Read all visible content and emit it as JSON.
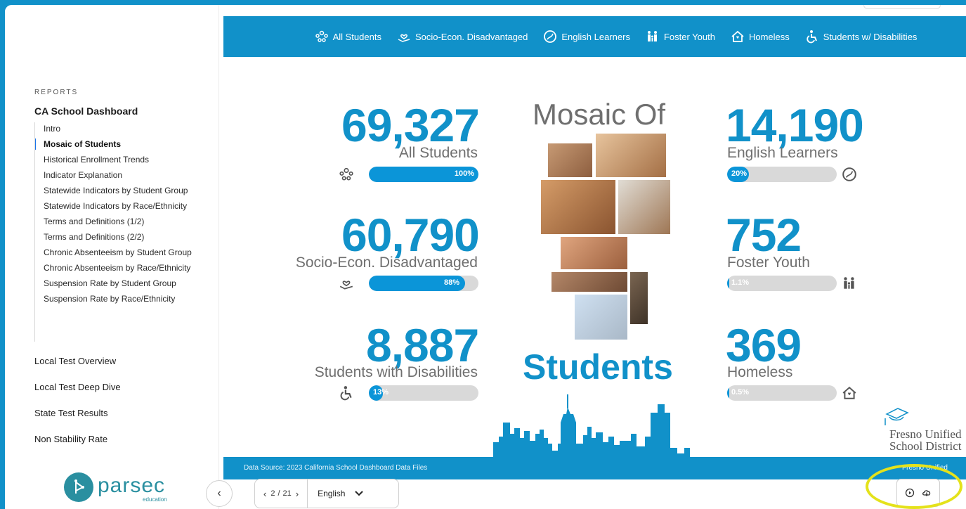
{
  "sidebar": {
    "reports_heading": "REPORTS",
    "section_title": "CA School Dashboard",
    "items": [
      {
        "label": "Intro"
      },
      {
        "label": "Mosaic of Students"
      },
      {
        "label": "Historical Enrollment Trends"
      },
      {
        "label": "Indicator Explanation"
      },
      {
        "label": "Statewide Indicators by Student Group"
      },
      {
        "label": "Statewide Indicators by Race/Ethnicity"
      },
      {
        "label": "Terms and Definitions (1/2)"
      },
      {
        "label": "Terms and Definitions (2/2)"
      },
      {
        "label": "Chronic Absenteeism by Student Group"
      },
      {
        "label": "Chronic Absenteeism by Race/Ethnicity"
      },
      {
        "label": "Suspension Rate by Student Group"
      },
      {
        "label": "Suspension Rate by Race/Ethnicity"
      }
    ],
    "active_item": "Mosaic of Students",
    "top_sections": [
      "Local Test Overview",
      "Local Test Deep Dive",
      "State Test Results",
      "Non Stability Rate"
    ],
    "logo_text": "parsec",
    "logo_sub": "education"
  },
  "report": {
    "groups": [
      {
        "label": "All Students",
        "icon": "group-icon"
      },
      {
        "label": "Socio-Econ. Disadvantaged",
        "icon": "hand-heart-icon"
      },
      {
        "label": "English Learners",
        "icon": "globe-icon"
      },
      {
        "label": "Foster Youth",
        "icon": "family-icon"
      },
      {
        "label": "Homeless",
        "icon": "house-icon"
      },
      {
        "label": "Students w/ Disabilities",
        "icon": "wheelchair-icon"
      }
    ],
    "title_top": "Mosaic Of",
    "title_bottom": "Students",
    "stats": [
      {
        "value": "69,327",
        "label": "All Students",
        "pct": 1.0,
        "pct_label": "100%",
        "icon": "group-icon"
      },
      {
        "value": "60,790",
        "label": "Socio-Econ. Disadvantaged",
        "pct": 0.88,
        "pct_label": "88%",
        "icon": "hand-heart-icon"
      },
      {
        "value": "8,887",
        "label": "Students with Disabilities",
        "pct": 0.13,
        "pct_label": "13%",
        "icon": "wheelchair-icon"
      },
      {
        "value": "14,190",
        "label": "English Learners",
        "pct": 0.2,
        "pct_label": "20%",
        "icon": "globe-icon"
      },
      {
        "value": "752",
        "label": "Foster Youth",
        "pct": 0.011,
        "pct_label": "1.1%",
        "icon": "family-icon"
      },
      {
        "value": "369",
        "label": "Homeless",
        "pct": 0.005,
        "pct_label": "0.5%",
        "icon": "house-icon"
      }
    ],
    "footer_source": "Data Source: 2023 California School Dashboard Data Files",
    "footer_right": "Fresno Unified",
    "district_logo_line1": "Fresno Unified",
    "district_logo_line2": "School District"
  },
  "pager": {
    "current": "2",
    "separator": "/",
    "total": "21",
    "language": "English"
  },
  "colors": {
    "brand": "#1191c9",
    "bar_fill": "#0b95d8",
    "highlight": "#e4e21b"
  }
}
